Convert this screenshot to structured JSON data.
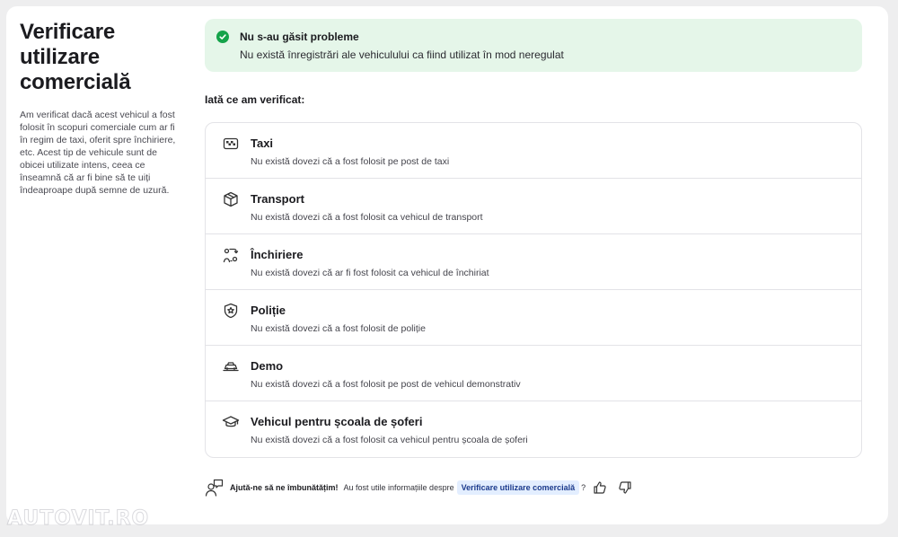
{
  "left": {
    "title": "Verificare utilizare comercială",
    "description": "Am verificat dacă acest vehicul a fost folosit în scopuri comerciale cum ar fi în regim de taxi, oferit spre închiriere, etc. Acest tip de vehicule sunt de obicei utilizate intens, ceea ce înseamnă că ar fi bine să te uiți îndeaproape după semne de uzură."
  },
  "alert": {
    "title": "Nu s-au găsit probleme",
    "text": "Nu există înregistrări ale vehiculului ca fiind utilizat în mod neregulat",
    "icon": "check-circle-icon",
    "color": "#15a34a",
    "background": "#e5f6e9"
  },
  "checked_heading": "Iată ce am verificat:",
  "checks": [
    {
      "title": "Taxi",
      "text": "Nu există dovezi că a fost folosit pe post de taxi",
      "icon": "taxi-icon"
    },
    {
      "title": "Transport",
      "text": "Nu există dovezi că a fost folosit ca vehicul de transport",
      "icon": "box-icon"
    },
    {
      "title": "Închiriere",
      "text": "Nu există dovezi că ar fi fost folosit ca vehicul de închiriat",
      "icon": "rental-swap-icon"
    },
    {
      "title": "Poliție",
      "text": "Nu există dovezi că a fost folosit de poliție",
      "icon": "police-badge-icon"
    },
    {
      "title": "Demo",
      "text": "Nu există dovezi că a fost folosit pe post de vehicul demonstrativ",
      "icon": "car-demo-icon"
    },
    {
      "title": "Vehicul pentru școala de șoferi",
      "text": "Nu există dovezi că a fost folosit ca vehicul pentru școala de șoferi",
      "icon": "graduation-cap-icon"
    }
  ],
  "feedback": {
    "bold": "Ajută-ne să ne îmbunătățim!",
    "text": "Au fost utile informațiile despre",
    "chip": "Verificare utilizare comercială",
    "question_mark": "?",
    "icon": "feedback-person-icon"
  },
  "watermark": "AUTOVIT.RO"
}
